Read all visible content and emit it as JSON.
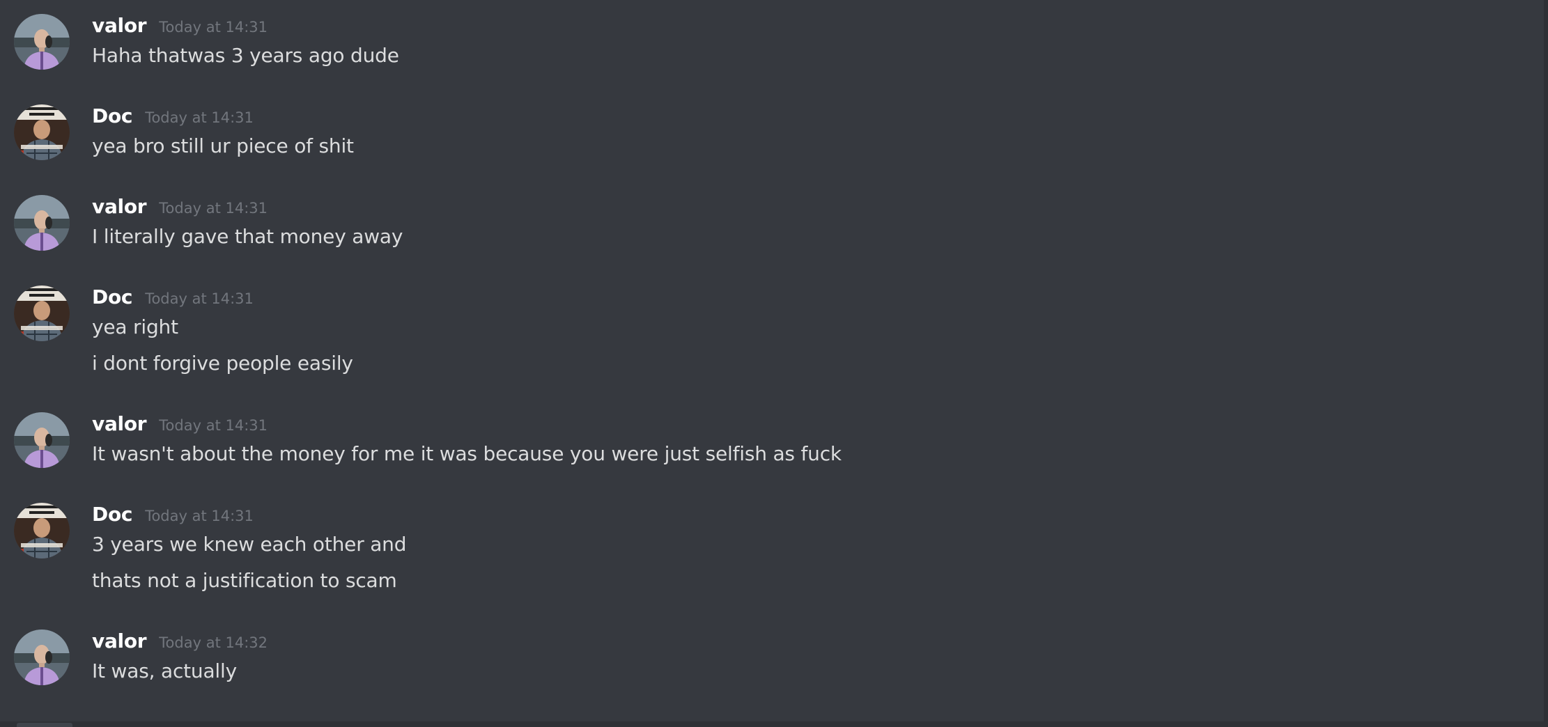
{
  "messages": [
    {
      "author": "valor",
      "avatar": "valor-avatar",
      "time": "Today at 14:31",
      "lines": [
        "Haha thatwas 3 years ago dude"
      ]
    },
    {
      "author": "Doc",
      "avatar": "doc-avatar",
      "time": "Today at 14:31",
      "lines": [
        "yea bro still ur piece of shit"
      ]
    },
    {
      "author": "valor",
      "avatar": "valor-avatar",
      "time": "Today at 14:31",
      "lines": [
        "I literally gave that money away"
      ]
    },
    {
      "author": "Doc",
      "avatar": "doc-avatar",
      "time": "Today at 14:31",
      "lines": [
        "yea right",
        "i dont forgive people easily"
      ]
    },
    {
      "author": "valor",
      "avatar": "valor-avatar",
      "time": "Today at 14:31",
      "lines": [
        "It wasn't about the money for me it was because you were just selfish as fuck"
      ]
    },
    {
      "author": "Doc",
      "avatar": "doc-avatar",
      "time": "Today at 14:31",
      "lines": [
        "3 years we knew each other and",
        "thats not a justification to scam"
      ]
    },
    {
      "author": "valor",
      "avatar": "valor-avatar",
      "time": "Today at 14:32",
      "lines": [
        "It was, actually"
      ]
    }
  ],
  "colors": {
    "background": "#36393f",
    "username": "#ffffff",
    "timestamp": "#72767d",
    "message_text": "#dcddde"
  }
}
